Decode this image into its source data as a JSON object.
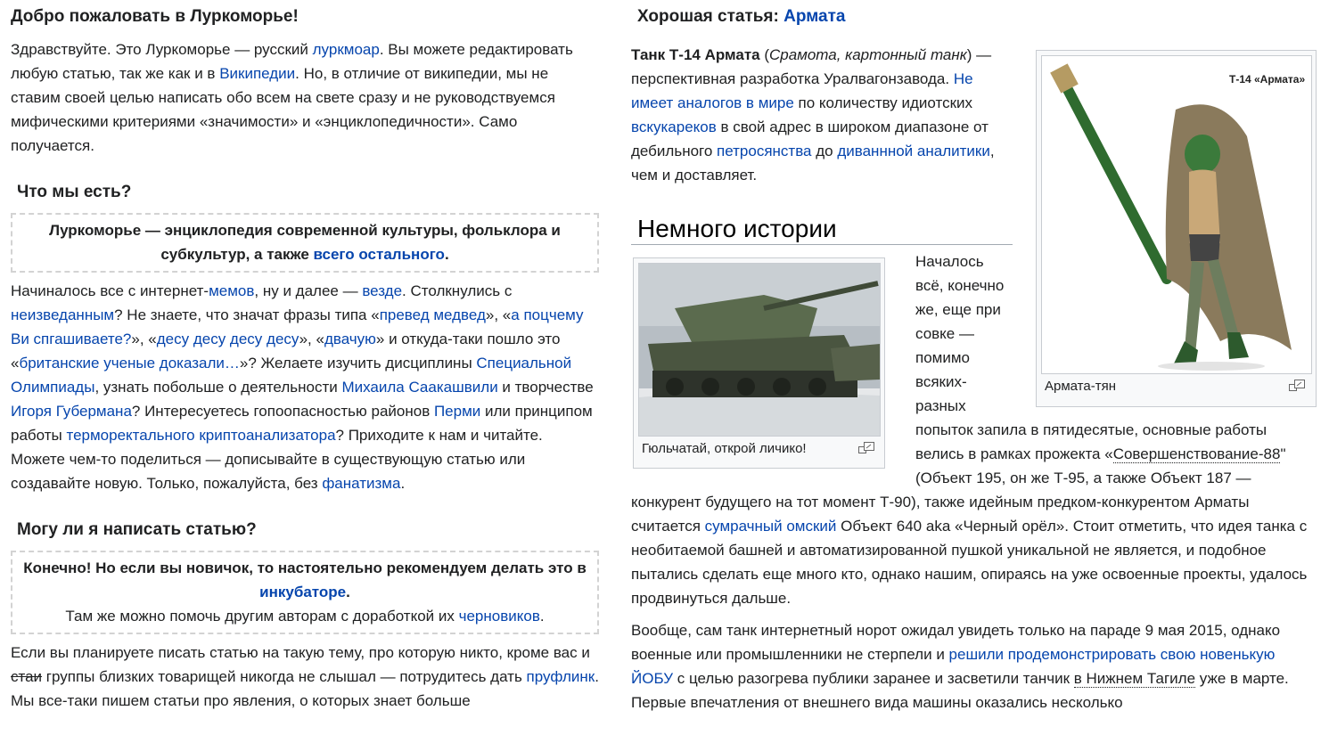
{
  "welcome": {
    "heading": "Добро пожаловать в Луркоморье!",
    "p1": [
      "Здравствуйте. Это Луркоморье — русский ",
      {
        "link": "луркмоар"
      },
      ". Вы можете редактировать любую статью, так же как и в ",
      {
        "link": "Википедии"
      },
      ". Но, в отличие от википедии, мы не ставим своей целью написать обо всем на свете сразу и не руководствуемся мифическими критериями «значимости» и «энциклопедичности». Само получается."
    ]
  },
  "what_we_are": {
    "heading": "Что мы есть?",
    "box": [
      "Луркоморье — энциклопедия современной культуры, фольклора и субкультур, а также ",
      {
        "link": "всего остального"
      },
      "."
    ],
    "p": [
      "Начиналось все с интернет-",
      {
        "link": "мемов"
      },
      ", ну и далее — ",
      {
        "link": "везде"
      },
      ". Столкнулись с ",
      {
        "link": "неизведанным"
      },
      "? Не знаете, что значат фразы типа «",
      {
        "link": "превед медвед"
      },
      "», «",
      {
        "link": "а поцчему Ви спгашиваете?"
      },
      "», «",
      {
        "link": "десу десу десу десу"
      },
      "», «",
      {
        "link": "двачую"
      },
      "» и откуда-таки пошло это «",
      {
        "link": "британские ученые доказали…"
      },
      "»? Желаете изучить дисциплины ",
      {
        "link": "Специальной Олимпиады"
      },
      ", узнать побольше о деятельности ",
      {
        "link": "Михаила Саакашвили"
      },
      " и творчестве ",
      {
        "link": "Игоря Губермана"
      },
      "? Интересуетесь гопоопасностью районов ",
      {
        "link": "Перми"
      },
      " или принципом работы ",
      {
        "link": "терморектального криптоанализатора"
      },
      "? Приходите к нам и читайте. Можете чем-то поделиться — дописывайте в существующую статью или создавайте новую. Только, пожалуйста, без ",
      {
        "link": "фанатизма"
      },
      "."
    ]
  },
  "can_i_write": {
    "heading": "Могу ли я написать статью?",
    "box_bold": [
      "Конечно! Но если вы новичок, то настоятельно рекомендуем делать это в ",
      {
        "link": "инкубаторе"
      },
      "."
    ],
    "box_normal": [
      "Там же можно помочь другим авторам с доработкой их ",
      {
        "link": "черновиков"
      },
      "."
    ],
    "p": [
      "Если вы планируете писать статью на такую тему, про которую никто, кроме вас и ",
      {
        "strike": "стаи"
      },
      " группы близких товарищей никогда не слышал — потрудитесь дать ",
      {
        "link": "пруфлинк"
      },
      ". Мы все-таки пишем статьи про явления, о которых знает больше"
    ]
  },
  "good_article": {
    "label": "Хорошая статья: ",
    "title_link": "Армата",
    "intro": [
      {
        "bold": "Танк Т-14 Армата"
      },
      " (",
      {
        "italic": "Срамота, картонный танк"
      },
      ") — перспективная разработка Уралвагонзавода. ",
      {
        "link": "Не имеет аналогов в мире"
      },
      " по количеству идиотских ",
      {
        "link": "вскукареков"
      },
      " в свой адрес в широком диапазоне от дебильного ",
      {
        "link": "петросянства"
      },
      " до ",
      {
        "link": "диваннной аналитики"
      },
      ", чем и доставляет."
    ],
    "history_heading": "Немного истории",
    "history_p1": [
      "Началось всё, конечно же, еще при совке — помимо всяких-разных попыток запила в пятидесятые, основные работы велись в рамках прожекта «",
      {
        "dotted": "Совершенствование-88"
      },
      "\" (Объект 195, он же Т-95, а также Объект 187 — конкурент будущего на тот момент Т-90), также идейным предком-конкурентом Арматы считается ",
      {
        "link": "сумрачный омский"
      },
      " Объект 640 aka «Черный орёл». Стоит отметить, что идея танка с необитаемой башней и автоматизированной пушкой уникальной не является, и подобное пытались сделать еще много кто, однако нашим, опираясь на уже освоенные проекты, удалось продвинуться дальше."
    ],
    "history_p2": [
      "Вообще, сам танк интернетный норот ожидал увидеть только на параде 9 мая 2015, однако военные или промышленники не стерпели и ",
      {
        "link": "решили продемонстрировать свою новенькую ЙОБУ"
      },
      " с целью разогрева публики заранее и засветили танчик ",
      {
        "dotted": "в Нижнем Тагиле"
      },
      " уже в марте. Первые впечатления от внешнего вида машины оказались несколько"
    ],
    "tank_caption": "Гюльчатай, открой личико!",
    "anime_caption": "Армата-тян",
    "anime_image_label": "Т-14 «Армата»"
  }
}
